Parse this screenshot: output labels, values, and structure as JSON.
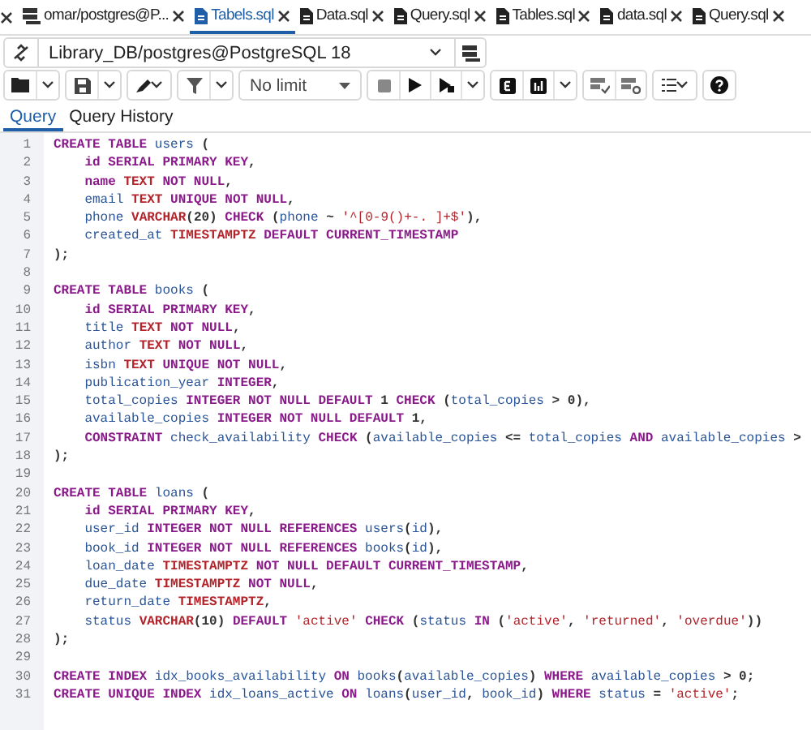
{
  "tabs": [
    {
      "label": "omar/postgres@P...",
      "kind": "connection",
      "selected": false
    },
    {
      "label": "Tabels.sql",
      "kind": "file",
      "selected": true
    },
    {
      "label": "Data.sql",
      "kind": "file",
      "selected": false
    },
    {
      "label": "Query.sql",
      "kind": "file",
      "selected": false
    },
    {
      "label": "Tables.sql",
      "kind": "file",
      "selected": false
    },
    {
      "label": "data.sql",
      "kind": "file",
      "selected": false
    },
    {
      "label": "Query.sql",
      "kind": "file",
      "selected": false
    }
  ],
  "connection": {
    "value": "Library_DB/postgres@PostgreSQL 18"
  },
  "toolbar": {
    "limit": "No limit"
  },
  "subtabs": [
    {
      "label": "Query",
      "selected": true
    },
    {
      "label": "Query History",
      "selected": false
    }
  ],
  "lines": [
    {
      "number": "1",
      "tokens": [
        {
          "kind": "keyword",
          "text": "CREATE TABLE "
        },
        {
          "kind": "name",
          "text": "users"
        },
        {
          "kind": "plain",
          "text": " ("
        }
      ]
    },
    {
      "number": "2",
      "tokens": [
        {
          "kind": "keyword",
          "text": "    id SERIAL PRIMARY KEY"
        },
        {
          "kind": "plain",
          "text": ","
        }
      ]
    },
    {
      "number": "3",
      "tokens": [
        {
          "kind": "keyword",
          "text": "    name"
        },
        {
          "kind": "type",
          "text": " TEXT"
        },
        {
          "kind": "keyword",
          "text": " NOT NULL"
        },
        {
          "kind": "plain",
          "text": ","
        }
      ]
    },
    {
      "number": "4",
      "tokens": [
        {
          "kind": "name",
          "text": "    email"
        },
        {
          "kind": "type",
          "text": " TEXT"
        },
        {
          "kind": "keyword",
          "text": " UNIQUE NOT NULL"
        },
        {
          "kind": "plain",
          "text": ","
        }
      ]
    },
    {
      "number": "5",
      "tokens": [
        {
          "kind": "name",
          "text": "    phone"
        },
        {
          "kind": "type",
          "text": " VARCHAR"
        },
        {
          "kind": "plain",
          "text": "("
        },
        {
          "kind": "number",
          "text": "20"
        },
        {
          "kind": "plain",
          "text": ") "
        },
        {
          "kind": "keyword",
          "text": "CHECK"
        },
        {
          "kind": "plain",
          "text": " ("
        },
        {
          "kind": "name",
          "text": "phone"
        },
        {
          "kind": "plain",
          "text": " ~ "
        },
        {
          "kind": "string",
          "text": "'^[0-9()+-. ]+$'"
        },
        {
          "kind": "plain",
          "text": "),"
        }
      ]
    },
    {
      "number": "6",
      "tokens": [
        {
          "kind": "name",
          "text": "    created_at"
        },
        {
          "kind": "type",
          "text": " TIMESTAMPTZ"
        },
        {
          "kind": "keyword",
          "text": " DEFAULT CURRENT_TIMESTAMP"
        }
      ]
    },
    {
      "number": "7",
      "tokens": [
        {
          "kind": "plain",
          "text": ");"
        }
      ]
    },
    {
      "number": "8"
    },
    {
      "number": "9",
      "tokens": [
        {
          "kind": "keyword",
          "text": "CREATE TABLE "
        },
        {
          "kind": "name",
          "text": "books"
        },
        {
          "kind": "plain",
          "text": " ("
        }
      ]
    },
    {
      "number": "10",
      "tokens": [
        {
          "kind": "keyword",
          "text": "    id SERIAL PRIMARY KEY"
        },
        {
          "kind": "plain",
          "text": ","
        }
      ]
    },
    {
      "number": "11",
      "tokens": [
        {
          "kind": "name",
          "text": "    title"
        },
        {
          "kind": "type",
          "text": " TEXT"
        },
        {
          "kind": "keyword",
          "text": " NOT NULL"
        },
        {
          "kind": "plain",
          "text": ","
        }
      ]
    },
    {
      "number": "12",
      "tokens": [
        {
          "kind": "name",
          "text": "    author"
        },
        {
          "kind": "type",
          "text": " TEXT"
        },
        {
          "kind": "keyword",
          "text": " NOT NULL"
        },
        {
          "kind": "plain",
          "text": ","
        }
      ]
    },
    {
      "number": "13",
      "tokens": [
        {
          "kind": "name",
          "text": "    isbn"
        },
        {
          "kind": "type",
          "text": " TEXT"
        },
        {
          "kind": "keyword",
          "text": " UNIQUE NOT NULL"
        },
        {
          "kind": "plain",
          "text": ","
        }
      ]
    },
    {
      "number": "14",
      "tokens": [
        {
          "kind": "name",
          "text": "    publication_year"
        },
        {
          "kind": "keyword",
          "text": " INTEGER"
        },
        {
          "kind": "plain",
          "text": ","
        }
      ]
    },
    {
      "number": "15",
      "tokens": [
        {
          "kind": "name",
          "text": "    total_copies"
        },
        {
          "kind": "keyword",
          "text": " INTEGER NOT NULL DEFAULT"
        },
        {
          "kind": "number",
          "text": " 1"
        },
        {
          "kind": "keyword",
          "text": " CHECK"
        },
        {
          "kind": "plain",
          "text": " ("
        },
        {
          "kind": "name",
          "text": "total_copies"
        },
        {
          "kind": "plain",
          "text": " > "
        },
        {
          "kind": "number",
          "text": "0"
        },
        {
          "kind": "plain",
          "text": "),"
        }
      ]
    },
    {
      "number": "16",
      "tokens": [
        {
          "kind": "name",
          "text": "    available_copies"
        },
        {
          "kind": "keyword",
          "text": " INTEGER NOT NULL DEFAULT"
        },
        {
          "kind": "number",
          "text": " 1"
        },
        {
          "kind": "plain",
          "text": ","
        }
      ]
    },
    {
      "number": "17",
      "tokens": [
        {
          "kind": "keyword",
          "text": "    CONSTRAINT"
        },
        {
          "kind": "name",
          "text": " check_availability"
        },
        {
          "kind": "keyword",
          "text": " CHECK"
        },
        {
          "kind": "plain",
          "text": " ("
        },
        {
          "kind": "name",
          "text": "available_copies"
        },
        {
          "kind": "plain",
          "text": " <= "
        },
        {
          "kind": "name",
          "text": "total_copies"
        },
        {
          "kind": "keyword",
          "text": " AND"
        },
        {
          "kind": "name",
          "text": " available_copies"
        },
        {
          "kind": "plain",
          "text": " >"
        }
      ]
    },
    {
      "number": "18",
      "tokens": [
        {
          "kind": "plain",
          "text": ");"
        }
      ]
    },
    {
      "number": "19"
    },
    {
      "number": "20",
      "tokens": [
        {
          "kind": "keyword",
          "text": "CREATE TABLE "
        },
        {
          "kind": "name",
          "text": "loans"
        },
        {
          "kind": "plain",
          "text": " ("
        }
      ]
    },
    {
      "number": "21",
      "tokens": [
        {
          "kind": "keyword",
          "text": "    id SERIAL PRIMARY KEY"
        },
        {
          "kind": "plain",
          "text": ","
        }
      ]
    },
    {
      "number": "22",
      "tokens": [
        {
          "kind": "name",
          "text": "    user_id"
        },
        {
          "kind": "keyword",
          "text": " INTEGER NOT NULL REFERENCES"
        },
        {
          "kind": "name",
          "text": " users"
        },
        {
          "kind": "plain",
          "text": "("
        },
        {
          "kind": "name",
          "text": "id"
        },
        {
          "kind": "plain",
          "text": "),"
        }
      ]
    },
    {
      "number": "23",
      "tokens": [
        {
          "kind": "name",
          "text": "    book_id"
        },
        {
          "kind": "keyword",
          "text": " INTEGER NOT NULL REFERENCES"
        },
        {
          "kind": "name",
          "text": " books"
        },
        {
          "kind": "plain",
          "text": "("
        },
        {
          "kind": "name",
          "text": "id"
        },
        {
          "kind": "plain",
          "text": "),"
        }
      ]
    },
    {
      "number": "24",
      "tokens": [
        {
          "kind": "name",
          "text": "    loan_date"
        },
        {
          "kind": "type",
          "text": " TIMESTAMPTZ"
        },
        {
          "kind": "keyword",
          "text": " NOT NULL DEFAULT CURRENT_TIMESTAMP"
        },
        {
          "kind": "plain",
          "text": ","
        }
      ]
    },
    {
      "number": "25",
      "tokens": [
        {
          "kind": "name",
          "text": "    due_date"
        },
        {
          "kind": "type",
          "text": " TIMESTAMPTZ"
        },
        {
          "kind": "keyword",
          "text": " NOT NULL"
        },
        {
          "kind": "plain",
          "text": ","
        }
      ]
    },
    {
      "number": "26",
      "tokens": [
        {
          "kind": "name",
          "text": "    return_date"
        },
        {
          "kind": "type",
          "text": " TIMESTAMPTZ"
        },
        {
          "kind": "plain",
          "text": ","
        }
      ]
    },
    {
      "number": "27",
      "tokens": [
        {
          "kind": "name",
          "text": "    status"
        },
        {
          "kind": "type",
          "text": " VARCHAR"
        },
        {
          "kind": "plain",
          "text": "("
        },
        {
          "kind": "number",
          "text": "10"
        },
        {
          "kind": "plain",
          "text": ") "
        },
        {
          "kind": "keyword",
          "text": "DEFAULT"
        },
        {
          "kind": "string",
          "text": " 'active'"
        },
        {
          "kind": "keyword",
          "text": " CHECK"
        },
        {
          "kind": "plain",
          "text": " ("
        },
        {
          "kind": "name",
          "text": "status"
        },
        {
          "kind": "keyword",
          "text": " IN"
        },
        {
          "kind": "plain",
          "text": " ("
        },
        {
          "kind": "string",
          "text": "'active'"
        },
        {
          "kind": "plain",
          "text": ", "
        },
        {
          "kind": "string",
          "text": "'returned'"
        },
        {
          "kind": "plain",
          "text": ", "
        },
        {
          "kind": "string",
          "text": "'overdue'"
        },
        {
          "kind": "plain",
          "text": "))"
        }
      ]
    },
    {
      "number": "28",
      "tokens": [
        {
          "kind": "plain",
          "text": ");"
        }
      ]
    },
    {
      "number": "29"
    },
    {
      "number": "30",
      "tokens": [
        {
          "kind": "keyword",
          "text": "CREATE INDEX "
        },
        {
          "kind": "name",
          "text": "idx_books_availability"
        },
        {
          "kind": "keyword",
          "text": " ON"
        },
        {
          "kind": "name",
          "text": " books"
        },
        {
          "kind": "plain",
          "text": "("
        },
        {
          "kind": "name",
          "text": "available_copies"
        },
        {
          "kind": "plain",
          "text": ") "
        },
        {
          "kind": "keyword",
          "text": "WHERE"
        },
        {
          "kind": "name",
          "text": " available_copies"
        },
        {
          "kind": "plain",
          "text": " > "
        },
        {
          "kind": "number",
          "text": "0"
        },
        {
          "kind": "plain",
          "text": ";"
        }
      ]
    },
    {
      "number": "31",
      "tokens": [
        {
          "kind": "keyword",
          "text": "CREATE UNIQUE INDEX "
        },
        {
          "kind": "name",
          "text": "idx_loans_active"
        },
        {
          "kind": "keyword",
          "text": " ON"
        },
        {
          "kind": "name",
          "text": " loans"
        },
        {
          "kind": "plain",
          "text": "("
        },
        {
          "kind": "name",
          "text": "user_id"
        },
        {
          "kind": "plain",
          "text": ", "
        },
        {
          "kind": "name",
          "text": "book_id"
        },
        {
          "kind": "plain",
          "text": ") "
        },
        {
          "kind": "keyword",
          "text": "WHERE"
        },
        {
          "kind": "name",
          "text": " status"
        },
        {
          "kind": "plain",
          "text": " = "
        },
        {
          "kind": "string",
          "text": "'active'"
        },
        {
          "kind": "plain",
          "text": ";"
        }
      ]
    }
  ]
}
